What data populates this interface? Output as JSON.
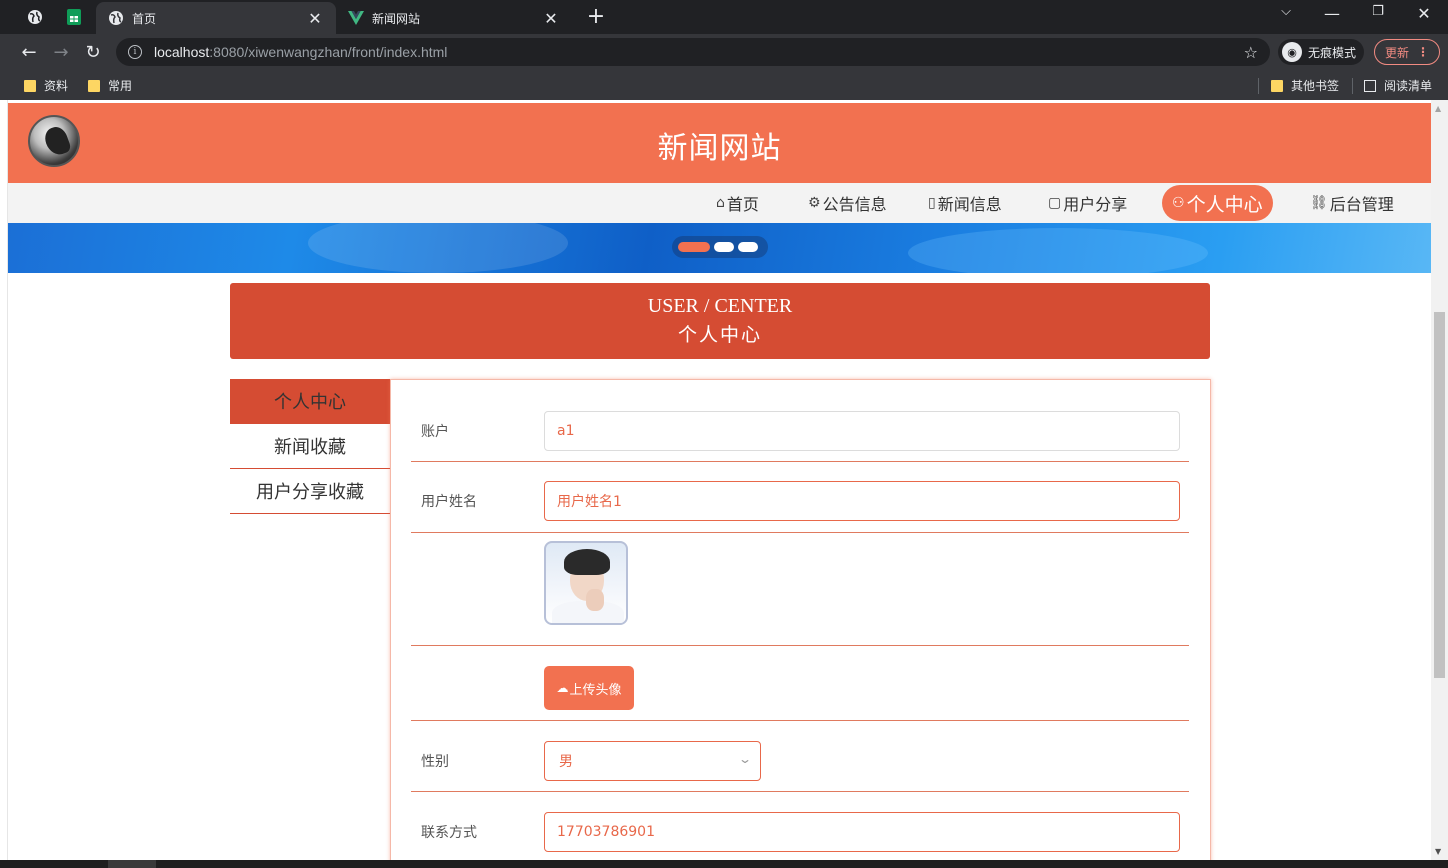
{
  "browser": {
    "tabs": [
      {
        "title": "首页",
        "active": true
      },
      {
        "title": "新闻网站",
        "active": false
      }
    ],
    "url_host": "localhost",
    "url_path": ":8080/xiwenwangzhan/front/index.html",
    "incognito_label": "无痕模式",
    "update_label": "更新",
    "bookmarks": [
      "资料",
      "常用"
    ],
    "bookmarks_right": [
      "其他书签",
      "阅读清单"
    ]
  },
  "site": {
    "title": "新闻网站",
    "nav": [
      {
        "label": "首页",
        "icon": "home-icon",
        "active": false
      },
      {
        "label": "公告信息",
        "icon": "announcement-icon",
        "active": false
      },
      {
        "label": "新闻信息",
        "icon": "news-icon",
        "active": false
      },
      {
        "label": "用户分享",
        "icon": "share-icon",
        "active": false
      },
      {
        "label": "个人中心",
        "icon": "user-icon",
        "active": true
      },
      {
        "label": "后台管理",
        "icon": "link-icon",
        "active": false
      }
    ],
    "carousel_active_index": 0,
    "carousel_count": 3
  },
  "user_center": {
    "title_en": "USER / CENTER",
    "title_cn": "个人中心",
    "side_menu": [
      {
        "label": "个人中心",
        "active": true
      },
      {
        "label": "新闻收藏",
        "active": false
      },
      {
        "label": "用户分享收藏",
        "active": false
      }
    ],
    "form": {
      "account_label": "账户",
      "account_value": "a1",
      "name_label": "用户姓名",
      "name_value": "用户姓名1",
      "upload_label": "上传头像",
      "gender_label": "性别",
      "gender_value": "男",
      "phone_label": "联系方式",
      "phone_value": "17703786901"
    }
  },
  "colors": {
    "accent": "#f27150",
    "header_dark": "#d54c33",
    "chrome_dark": "#202124",
    "chrome_mid": "#35363a"
  }
}
